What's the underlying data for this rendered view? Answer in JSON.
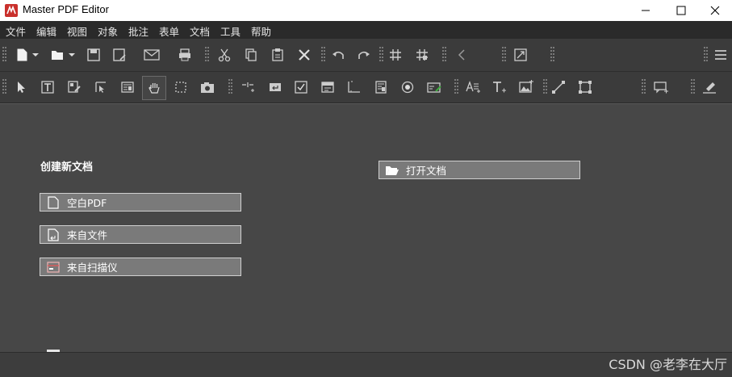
{
  "app": {
    "title": "Master PDF Editor"
  },
  "menu": [
    "文件",
    "编辑",
    "视图",
    "对象",
    "批注",
    "表单",
    "文档",
    "工具",
    "帮助"
  ],
  "start": {
    "create_heading": "创建新文档",
    "blank_pdf": "空白PDF",
    "from_file": "来自文件",
    "from_scanner": "来自扫描仪",
    "open_document": "打开文档"
  },
  "search": {
    "placeholder": ""
  },
  "watermark": "CSDN @老李在大厅",
  "colors": {
    "accent": "#c9302c",
    "background": "#474747",
    "button": "#7a7a7a"
  }
}
